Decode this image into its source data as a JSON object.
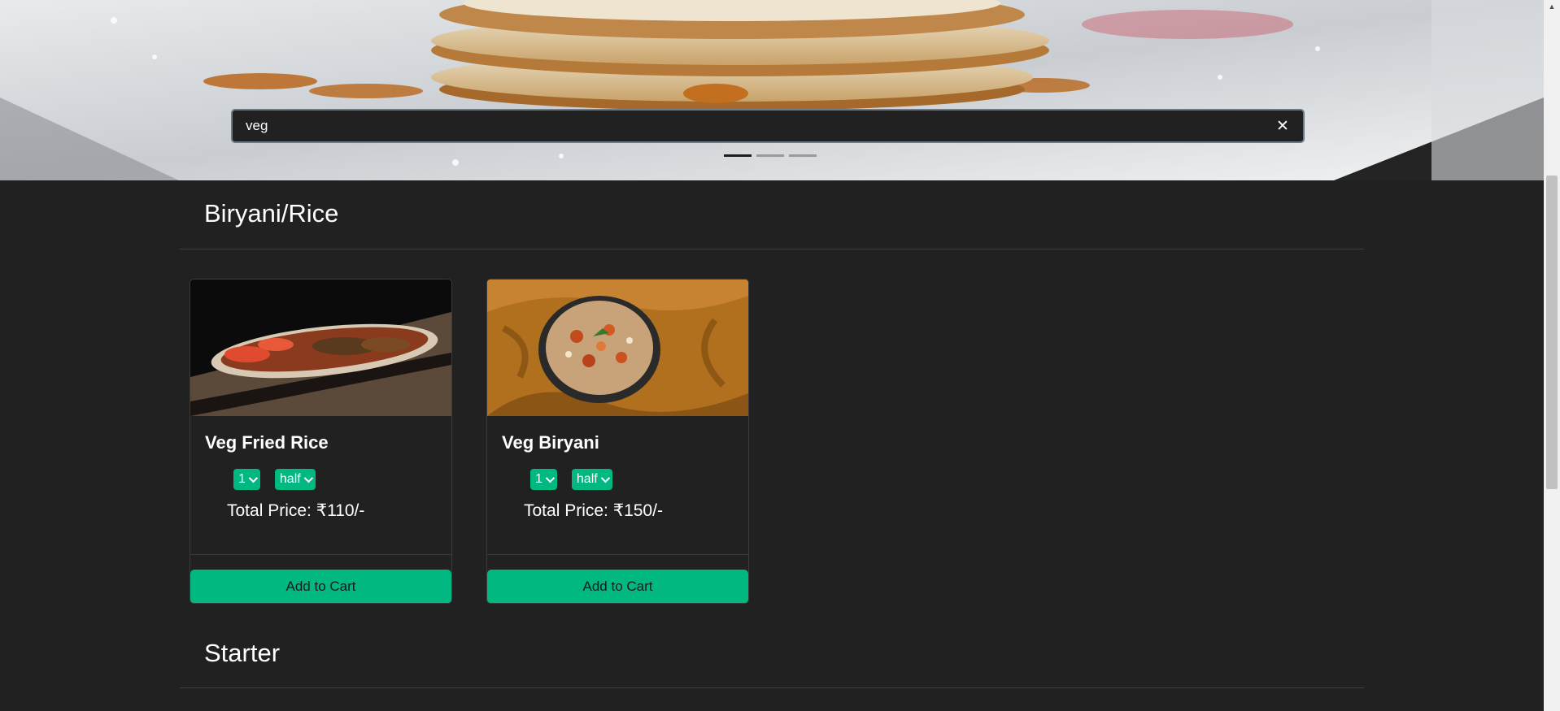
{
  "search": {
    "value": "veg",
    "clear_icon": "close-icon"
  },
  "carousel": {
    "slide_count": 3,
    "active_index": 0
  },
  "sections": [
    {
      "title": "Biryani/Rice",
      "items": [
        {
          "name": "Veg Fried Rice",
          "quantity": "1",
          "size": "half",
          "price_label": "Total Price: ₹110/-",
          "button_label": "Add to Cart"
        },
        {
          "name": "Veg Biryani",
          "quantity": "1",
          "size": "half",
          "price_label": "Total Price: ₹150/-",
          "button_label": "Add to Cart"
        }
      ]
    },
    {
      "title": "Starter",
      "items": []
    }
  ],
  "colors": {
    "background": "#212121",
    "accent": "#00b880",
    "text": "#ffffff"
  }
}
